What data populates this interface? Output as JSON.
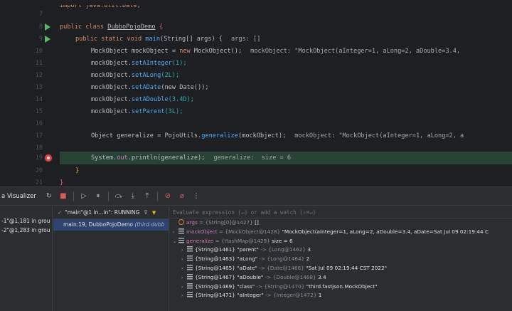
{
  "editor": {
    "lines": [
      {
        "n": "7",
        "marker": "none"
      },
      {
        "n": "8",
        "marker": "run"
      },
      {
        "n": "9",
        "marker": "run"
      },
      {
        "n": "10",
        "marker": "none"
      },
      {
        "n": "11",
        "marker": "none"
      },
      {
        "n": "12",
        "marker": "none"
      },
      {
        "n": "13",
        "marker": "none"
      },
      {
        "n": "14",
        "marker": "none"
      },
      {
        "n": "15",
        "marker": "none"
      },
      {
        "n": "16",
        "marker": "none"
      },
      {
        "n": "17",
        "marker": "none"
      },
      {
        "n": "18",
        "marker": "none"
      },
      {
        "n": "19",
        "marker": "breakpoint"
      },
      {
        "n": "20",
        "marker": "none"
      },
      {
        "n": "21",
        "marker": "none"
      }
    ],
    "code": {
      "l6": "import java.util.Date;",
      "l8_kw": "public class ",
      "l8_cls": "DubboPojoDemo",
      "l8_brace": " {",
      "l9_kw": "public static void ",
      "l9_fn": "main",
      "l9_rest": "(String[] args) {",
      "l9_hint": "args: []",
      "l10_a": "MockObject mockObject = ",
      "l10_kw": "new ",
      "l10_b": "MockObject();",
      "l10_hint": "mockObject: \"MockObject(aInteger=1, aLong=2, aDouble=3.4,",
      "l11_obj": "mockObject.",
      "l11_fn": "setAInteger",
      "l11_arg": "(1);",
      "l12_obj": "mockObject.",
      "l12_fn": "setALong",
      "l12_arg": "(2L);",
      "l13_obj": "mockObject.",
      "l13_fn": "setADate",
      "l13_arg": "(new Date());",
      "l14_obj": "mockObject.",
      "l14_fn": "setADouble",
      "l14_arg": "(3.4D);",
      "l15_obj": "mockObject.",
      "l15_fn": "setParent",
      "l15_arg": "(3L);",
      "l17_a": "Object generalize = PojoUtils.",
      "l17_fn": "generalize",
      "l17_b": "(mockObject);",
      "l17_hint": "mockObject: \"MockObject(aInteger=1, aLong=2, a",
      "l19_a": "System.",
      "l19_out": "out",
      "l19_b": ".println(generalize);",
      "l19_hint": "generalize:  size = 6",
      "l20": "}",
      "l21": "}"
    }
  },
  "debug": {
    "tool_title": "a Visualizer",
    "threads_left": [
      "-1\"@1,181 in grou",
      "-2\"@1,283 in grou"
    ],
    "thread_select": "\"main\"@1 in...in\": RUNNING",
    "frame": {
      "method": "main:19, DubboPojoDemo ",
      "location": "(third.dubb"
    },
    "eval_placeholder": "Evaluate expression (↵) or add a watch (⇧⌘↵)",
    "vars": [
      {
        "name": "args",
        "type": " = {String[0]@1427} ",
        "value": "[]",
        "level": 0,
        "icon": "p",
        "arrow": ""
      },
      {
        "name": "mockObject",
        "type": " = {MockObject@1428} ",
        "value": "\"MockObject(aInteger=1, aLong=2, aDouble=3.4, aDate=Sat Jul 09 02:19:44 C",
        "level": 0,
        "icon": "f",
        "arrow": "›"
      },
      {
        "name": "generalize",
        "type": " = {HashMap@1429} ",
        "value": " size = 6",
        "level": 0,
        "icon": "f",
        "arrow": "⌄"
      },
      {
        "name": "{String@1461} \"parent\"",
        "type": " -> {Long@1462} ",
        "value": "3",
        "level": 1,
        "icon": "f",
        "arrow": "›"
      },
      {
        "name": "{String@1463} \"aLong\"",
        "type": " -> {Long@1464} ",
        "value": "2",
        "level": 1,
        "icon": "f",
        "arrow": "›"
      },
      {
        "name": "{String@1465} \"aDate\"",
        "type": " -> {Date@1466} ",
        "value": "\"Sat Jul 09 02:19:44 CST 2022\"",
        "level": 1,
        "icon": "f",
        "arrow": "›"
      },
      {
        "name": "{String@1467} \"aDouble\"",
        "type": " -> {Double@1468} ",
        "value": "3.4",
        "level": 1,
        "icon": "f",
        "arrow": "›"
      },
      {
        "name": "{String@1469} \"class\"",
        "type": " -> {String@1470} ",
        "value": "\"third.fastjson.MockObject\"",
        "level": 1,
        "icon": "f",
        "arrow": "›"
      },
      {
        "name": "{String@1471} \"aInteger\"",
        "type": " -> {Integer@1472} ",
        "value": "1",
        "level": 1,
        "icon": "f",
        "arrow": "›"
      }
    ]
  },
  "colors": {
    "editor_bg": "#1e1f22",
    "highlight_line": "#294436",
    "keyword": "#cf8e6d",
    "function": "#56a8f5",
    "number": "#2aacb8",
    "panel_bg": "#2b2d30",
    "selected_frame": "#2e436e"
  }
}
